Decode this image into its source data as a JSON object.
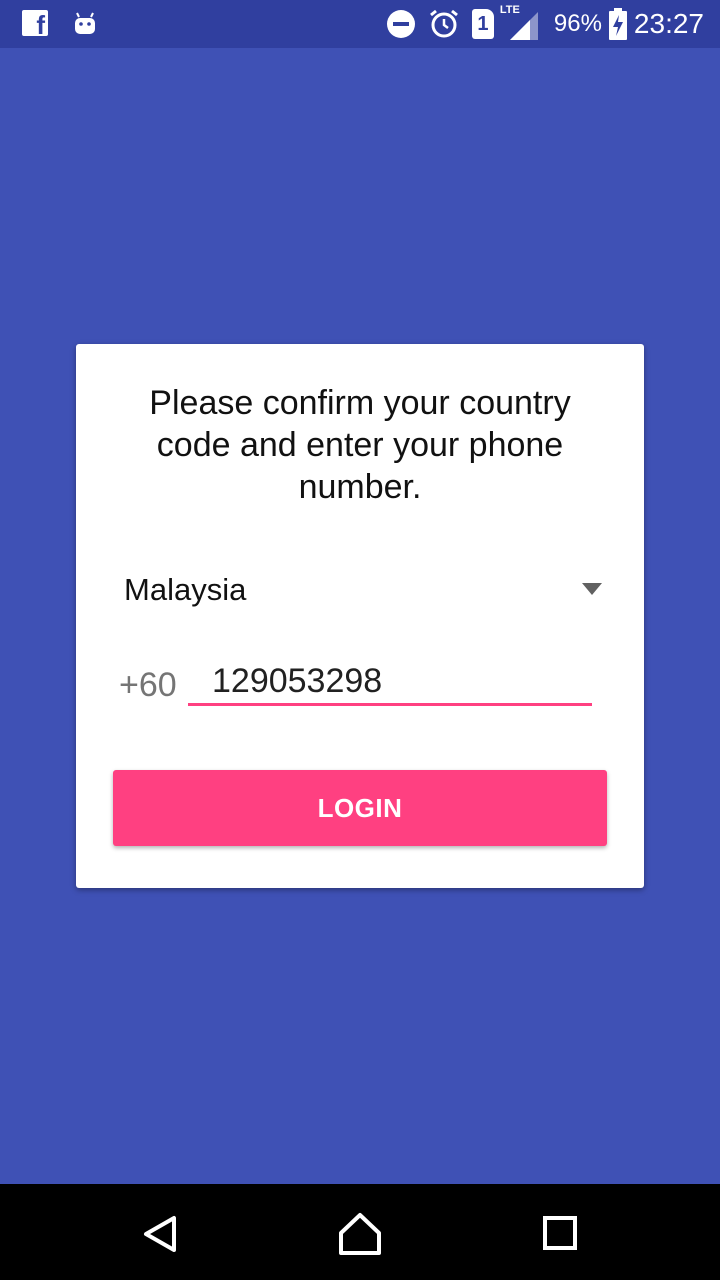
{
  "status_bar": {
    "left_icons": [
      "facebook-icon",
      "android-icon"
    ],
    "sim_slot": "1",
    "network_type": "LTE",
    "battery_percent": "96%",
    "time": "23:27"
  },
  "login_card": {
    "prompt": "Please confirm your country code and enter your phone number.",
    "country": "Malaysia",
    "dial_code": "+60",
    "phone_number": "129053298",
    "login_label": "LOGIN"
  },
  "colors": {
    "primary": "#3f51b5",
    "primary_dark": "#303f9f",
    "accent": "#ff4081"
  },
  "nav_bar": {
    "buttons": [
      "back-icon",
      "home-icon",
      "recents-icon"
    ]
  }
}
